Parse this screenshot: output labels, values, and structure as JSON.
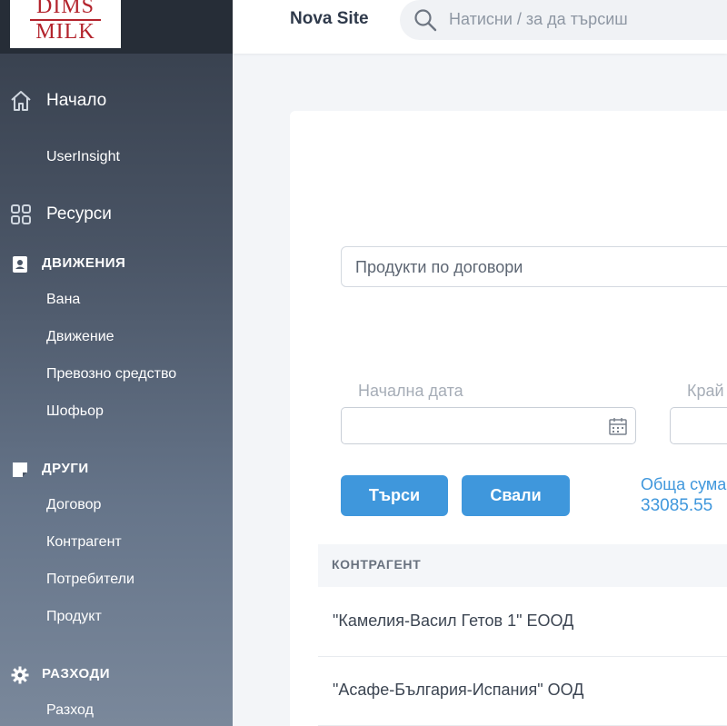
{
  "brand": {
    "logo_line1": "DIMS",
    "logo_line2": "MILK",
    "logo_color": "#b3232c"
  },
  "header": {
    "site_name": "Nova Site",
    "search_placeholder": "Натисни / за да търсиш"
  },
  "sidebar": {
    "home": {
      "label": "Начало",
      "icon": "home-icon"
    },
    "userinsight": "UserInsight",
    "resources": {
      "label": "Ресурси",
      "icon": "grid-icon"
    },
    "sections": [
      {
        "title": "ДВИЖЕНИЯ",
        "icon": "contact-book-icon",
        "items": [
          "Вана",
          "Движение",
          "Превозно средство",
          "Шофьор"
        ]
      },
      {
        "title": "ДРУГИ",
        "icon": "sticky-note-icon",
        "items": [
          "Договор",
          "Контрагент",
          "Потребители",
          "Продукт"
        ]
      },
      {
        "title": "РАЗХОДИ",
        "icon": "gear-icon",
        "items": [
          "Разход"
        ]
      }
    ]
  },
  "main": {
    "report_select": "Продукти по договори",
    "start_date_label": "Начална дата",
    "end_date_label": "Край",
    "search_button": "Търси",
    "download_button": "Свали",
    "total_label": "Обща сума",
    "total_value": "33085.55",
    "table": {
      "columns": [
        "КОНТРАГЕНТ"
      ],
      "rows": [
        "\"Камелия-Васил Гетов 1\" ЕООД",
        "\"Асафе-България-Испания\" ООД"
      ]
    }
  },
  "colors": {
    "accent": "#3f97dc",
    "sidebar_top": "#353d4a",
    "sidebar_bottom": "#7a889b"
  }
}
